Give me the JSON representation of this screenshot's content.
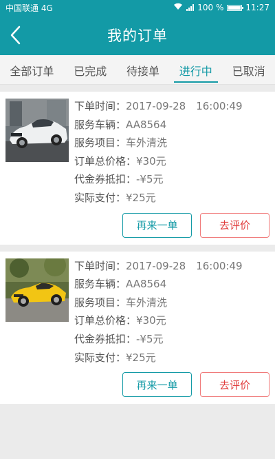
{
  "statusbar": {
    "carrier": "中国联通 4G",
    "battery": "100 %",
    "battery_level": 1.0,
    "time": "11:27"
  },
  "header": {
    "title": "我的订单"
  },
  "tabs": [
    {
      "label": "全部订单"
    },
    {
      "label": "已完成"
    },
    {
      "label": "待接单"
    },
    {
      "label": "进行中"
    },
    {
      "label": "已取消"
    }
  ],
  "labels": {
    "order_time": "下单时间：",
    "vehicle": "服务车辆：",
    "service": "服务项目：",
    "total": "订单总价格：",
    "coupon": "代金券抵扣：",
    "paid": "实际支付："
  },
  "orders": [
    {
      "image": "white-sedan-photo",
      "order_time": "2017-09-28　16:00:49",
      "vehicle": "AA8564",
      "service": "车外清洗",
      "total": "¥30元",
      "coupon": "-¥5元",
      "paid": "¥25元",
      "reorder_label": "再来一单",
      "review_label": "去评价"
    },
    {
      "image": "yellow-sportscar-photo",
      "order_time": "2017-09-28　16:00:49",
      "vehicle": "AA8564",
      "service": "车外清洗",
      "total": "¥30元",
      "coupon": "-¥5元",
      "paid": "¥25元",
      "reorder_label": "再来一单",
      "review_label": "去评价"
    }
  ],
  "colors": {
    "primary": "#139aa6",
    "danger": "#e03c3c",
    "background": "#ebebeb"
  }
}
